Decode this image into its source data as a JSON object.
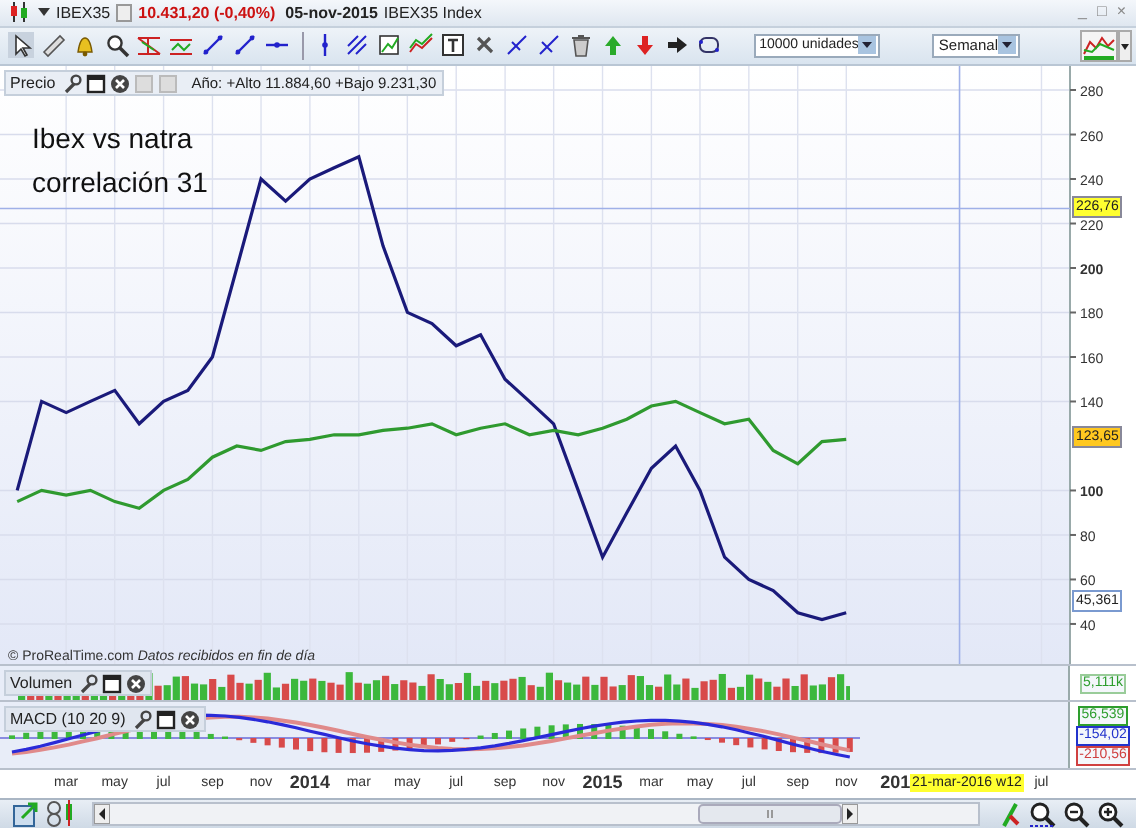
{
  "window": {
    "symbol": "IBEX35",
    "quote": "10.431,20 (-0,40%)",
    "date": "05-nov-2015",
    "instrument": "IBEX35 Index",
    "controls": [
      "_",
      "□",
      "×"
    ]
  },
  "toolbar": {
    "quantity": "10000 unidades",
    "period": "Semanal"
  },
  "price_panel": {
    "title": "Precio",
    "stats": "Año: +Alto 11.884,60 +Bajo 9.231,30",
    "notes": [
      "Ibex vs natra",
      "correlación 31"
    ],
    "credit": "© ProRealTime.com *Datos recibidos en fin de día*",
    "markers": [
      {
        "text": "226,76",
        "kind": "crosshair"
      },
      {
        "text": "123,65",
        "kind": "last"
      },
      {
        "text": "45,361",
        "kind": "compare"
      }
    ],
    "chart_data": {
      "type": "line",
      "x": [
        2013.0,
        2013.083,
        2013.167,
        2013.25,
        2013.333,
        2013.417,
        2013.5,
        2013.583,
        2013.667,
        2013.75,
        2013.833,
        2013.917,
        2014.0,
        2014.083,
        2014.167,
        2014.25,
        2014.333,
        2014.417,
        2014.5,
        2014.583,
        2014.667,
        2014.75,
        2014.833,
        2014.917,
        2015.0,
        2015.083,
        2015.167,
        2015.25,
        2015.333,
        2015.417,
        2015.5,
        2015.583,
        2015.667,
        2015.75,
        2015.833
      ],
      "series": [
        {
          "color": "#1a1a7a",
          "values": [
            100,
            140,
            135,
            140,
            145,
            130,
            140,
            145,
            160,
            200,
            240,
            230,
            240,
            245,
            250,
            210,
            180,
            175,
            165,
            170,
            150,
            140,
            130,
            100,
            70,
            90,
            110,
            120,
            100,
            70,
            60,
            55,
            45,
            42,
            45
          ]
        },
        {
          "color": "#2f9a2f",
          "values": [
            95,
            100,
            98,
            100,
            95,
            92,
            100,
            105,
            115,
            120,
            118,
            122,
            123,
            125,
            125,
            127,
            128,
            130,
            125,
            128,
            130,
            125,
            127,
            125,
            128,
            132,
            138,
            140,
            135,
            130,
            132,
            118,
            112,
            122,
            123
          ]
        }
      ],
      "xlim": [
        2012.941,
        2016.823
      ],
      "ylim": [
        22,
        290.8
      ],
      "grid": true,
      "ref_lines": [
        {
          "axis": "y",
          "value": 226.76
        },
        {
          "axis": "x",
          "value": 2016.22
        }
      ],
      "yticks": [
        {
          "value": 40,
          "label": "40"
        },
        {
          "value": 60,
          "label": "60"
        },
        {
          "value": 80,
          "label": "80"
        },
        {
          "value": 100,
          "label": "100"
        },
        {
          "value": 140,
          "label": "140"
        },
        {
          "value": 160,
          "label": "160"
        },
        {
          "value": 180,
          "label": "180"
        },
        {
          "value": 200,
          "label": "200"
        },
        {
          "value": 220,
          "label": "220"
        },
        {
          "value": 240,
          "label": "240"
        },
        {
          "value": 260,
          "label": "260"
        },
        {
          "value": 280,
          "label": "280"
        }
      ],
      "xticks": [
        {
          "value": 2013.167,
          "label": "mar"
        },
        {
          "value": 2013.333,
          "label": "may"
        },
        {
          "value": 2013.5,
          "label": "jul"
        },
        {
          "value": 2013.667,
          "label": "sep"
        },
        {
          "value": 2013.833,
          "label": "nov"
        },
        {
          "value": 2014,
          "label": "2014"
        },
        {
          "value": 2014.167,
          "label": "mar"
        },
        {
          "value": 2014.333,
          "label": "may"
        },
        {
          "value": 2014.5,
          "label": "jul"
        },
        {
          "value": 2014.667,
          "label": "sep"
        },
        {
          "value": 2014.833,
          "label": "nov"
        },
        {
          "value": 2015,
          "label": "2015"
        },
        {
          "value": 2015.167,
          "label": "mar"
        },
        {
          "value": 2015.333,
          "label": "may"
        },
        {
          "value": 2015.5,
          "label": "jul"
        },
        {
          "value": 2015.667,
          "label": "sep"
        },
        {
          "value": 2015.833,
          "label": "nov"
        },
        {
          "value": 2016.5,
          "label": "jul"
        }
      ]
    }
  },
  "volume_panel": {
    "title": "Volumen",
    "reading": "5,111k"
  },
  "macd_panel": {
    "title": "MACD (10 20 9)",
    "readings": [
      {
        "text": "56,539",
        "color": "#2e9e2e"
      },
      {
        "text": "-154,02",
        "color": "#2233cc"
      },
      {
        "text": "-210,56",
        "color": "#d04040"
      }
    ]
  },
  "partial_axis_label": "201",
  "cursor_date": "21-mar-2016 w12"
}
